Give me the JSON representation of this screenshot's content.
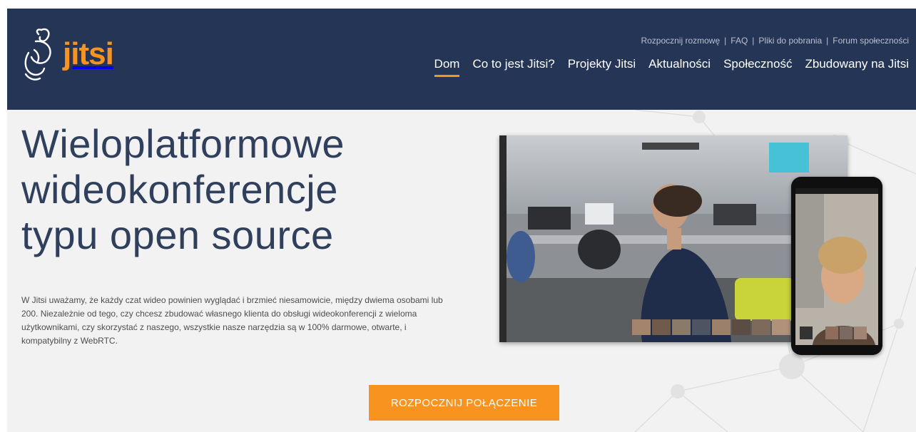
{
  "brand": {
    "name": "jitsi",
    "accent_color": "#f7931e",
    "header_color": "#253556",
    "logo_icon": "jitsi-logo-icon"
  },
  "top_links": [
    {
      "label": "Rozpocznij rozmowę"
    },
    {
      "label": "FAQ"
    },
    {
      "label": "Pliki do pobrania"
    },
    {
      "label": "Forum społeczności"
    }
  ],
  "top_links_separator": "|",
  "nav": [
    {
      "label": "Dom",
      "active": true
    },
    {
      "label": "Co to jest Jitsi?",
      "active": false
    },
    {
      "label": "Projekty Jitsi",
      "active": false
    },
    {
      "label": "Aktualności",
      "active": false
    },
    {
      "label": "Społeczność",
      "active": false
    },
    {
      "label": "Zbudowany na Jitsi",
      "active": false
    }
  ],
  "hero": {
    "title_lines": [
      "Wieloplatformowe",
      "wideokonferencje",
      "typu open source"
    ],
    "description": "W Jitsi uważamy, że każdy czat wideo powinien wyglądać i brzmieć niesamowicie, między dwiema osobami lub 200. Niezależnie od tego, czy chcesz zbudować własnego klienta do obsługi wideokonferencji z wieloma użytkownikami, czy skorzystać z naszego, wszystkie nasze narzędzia są w 100% darmowe, otwarte, i kompatybilny z WebRTC.",
    "cta_label": "ROZPOCZNIJ POŁĄCZENIE"
  },
  "media": {
    "laptop_image": "video-conference-screenshot",
    "phone_image": "mobile-video-call-screenshot"
  }
}
